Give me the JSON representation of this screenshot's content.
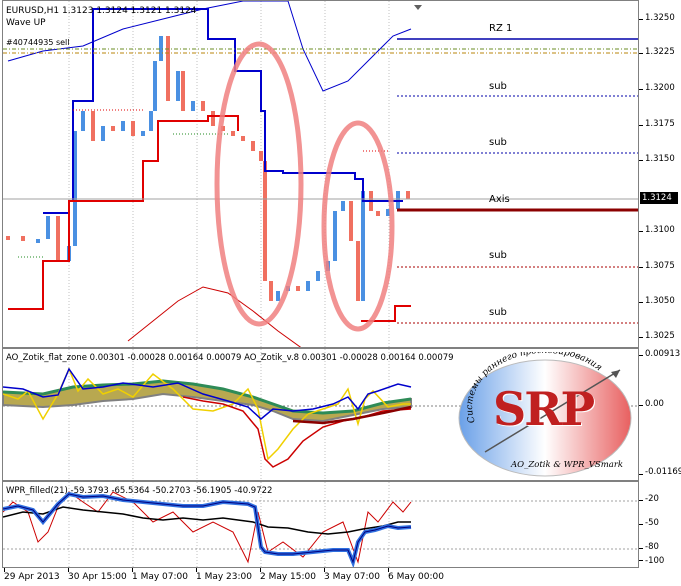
{
  "main": {
    "header": "EURUSD,H1  1.3123 1.3124 1.3121 1.3124",
    "indicator": "Wave UP",
    "order": "#40744935 sell",
    "current_price": "1.3124",
    "price_ticks": [
      "1.3250",
      "1.3225",
      "1.3200",
      "1.3175",
      "1.3150",
      "1.3124",
      "1.3100",
      "1.3075",
      "1.3050",
      "1.3025"
    ],
    "levels": [
      "RZ 1",
      "sub",
      "sub",
      "Axis",
      "sub",
      "sub"
    ],
    "colors": {
      "bull": "#4a90e2",
      "bear": "#f07060",
      "support": "#e00000",
      "resist": "#0000cc",
      "axis": "#8b0000",
      "ellipse": "#f08080"
    }
  },
  "ao": {
    "header": "AO_Zotik_flat_zone 0.00301 -0.00028 0.00164 0.00079  AO_Zotik_v.8 0.00301 -0.00028 0.00164 0.00079",
    "ticks": [
      "0.00913",
      "0.00",
      "-0.01169"
    ]
  },
  "wpr": {
    "header": "WPR_filled(21) -59.3793 -65.5364 -50.2703 -56.1905 -40.9722",
    "ticks": [
      "-20",
      "-50",
      "-80",
      "-100"
    ]
  },
  "logo": {
    "letters": "SRP",
    "arc_text": "Системы раннего прогнозирования",
    "sub_text": "AO_Zotik & WPR_VSmark"
  },
  "time_labels": [
    "29 Apr 2013",
    "30 Apr 15:00",
    "1 May 07:00",
    "1 May 23:00",
    "2 May 15:00",
    "3 May 07:00",
    "6 May 00:00"
  ]
}
